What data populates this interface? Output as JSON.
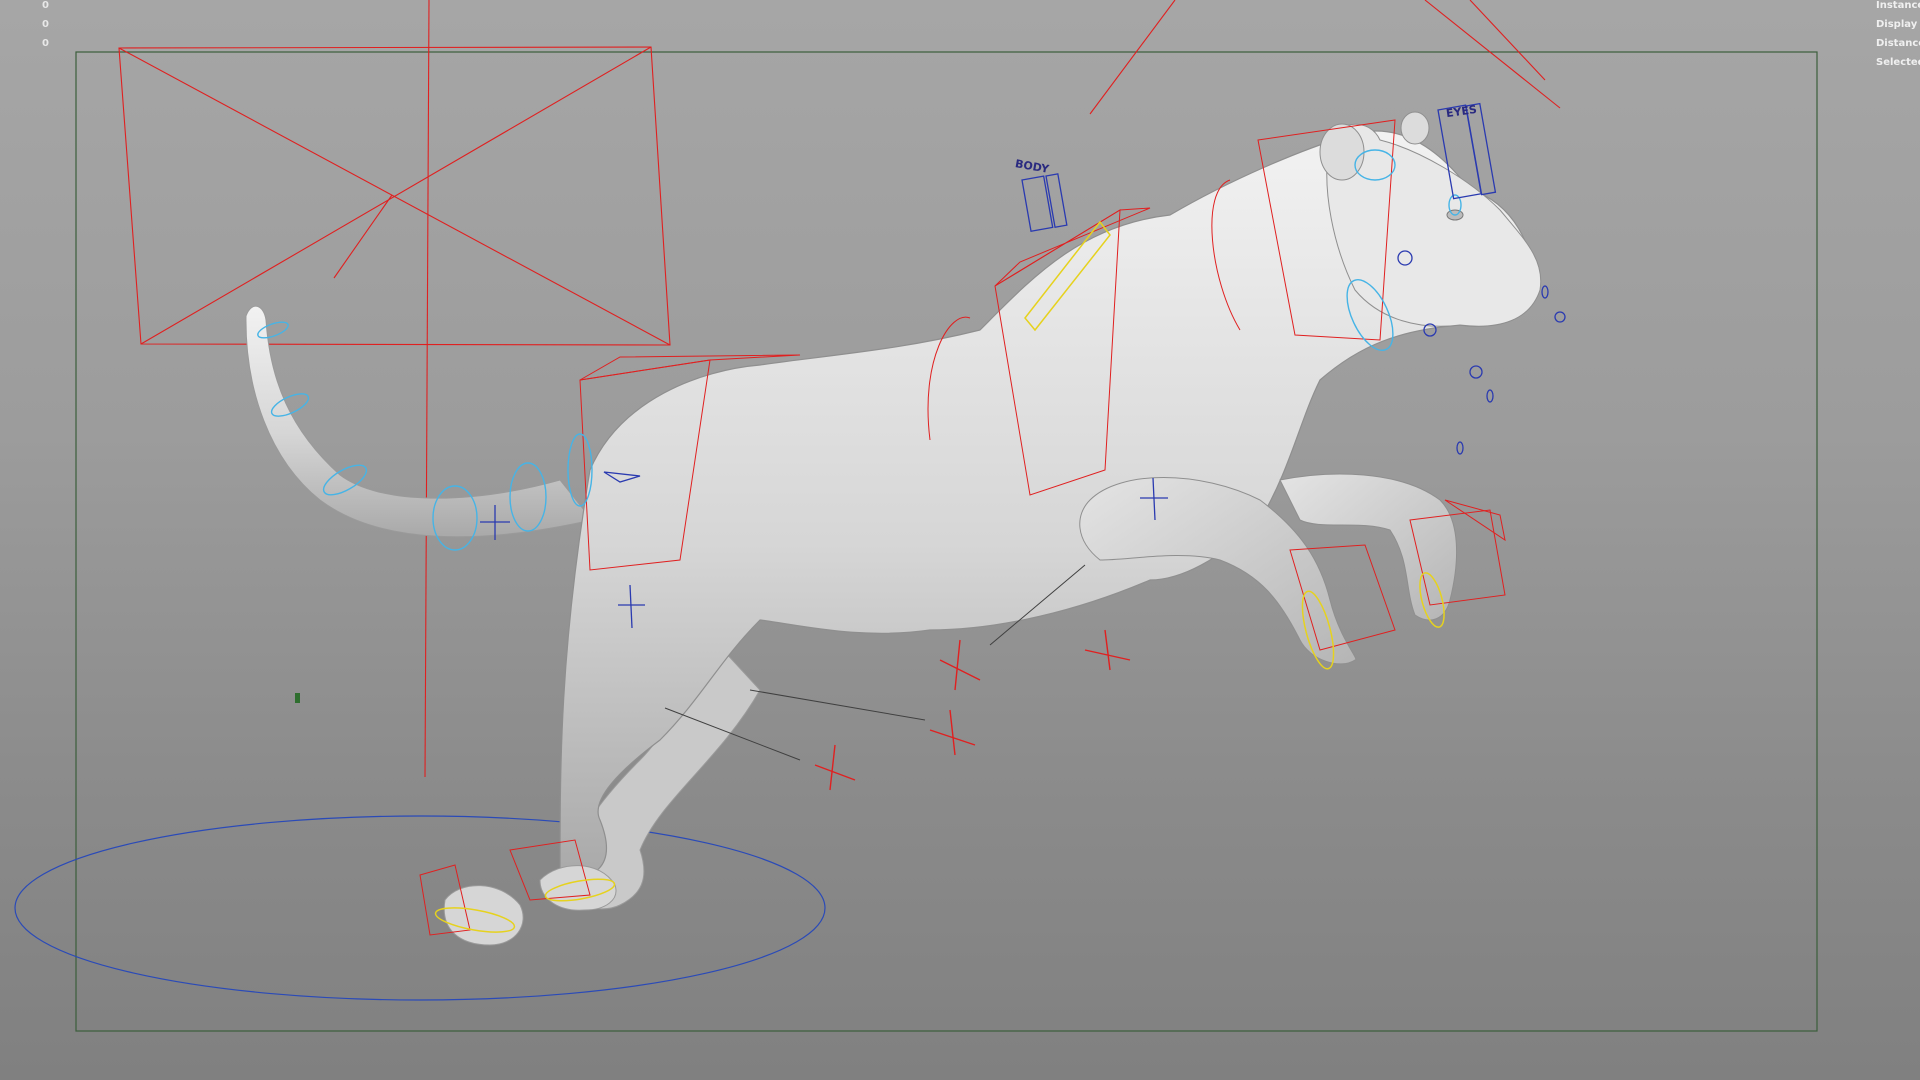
{
  "app": {
    "panel": "3D viewport - animation rig"
  },
  "hud": {
    "left_values": [
      "0",
      "0",
      "0"
    ],
    "right_labels": [
      "Instance",
      "Display La",
      "Distance F",
      "Selected C"
    ]
  },
  "rig_labels": {
    "body": "BODY",
    "eyes": "EYES"
  },
  "colors": {
    "background_top": "#a6a6a6",
    "background_bottom": "#808080",
    "resolution_gate": "#3b5e3b",
    "rig_red": "#e02020",
    "rig_cyan": "#46b4e6",
    "rig_blue": "#2a3ab0",
    "rig_yellow": "#e6d21e",
    "model_grey": "#d9d9d9"
  }
}
